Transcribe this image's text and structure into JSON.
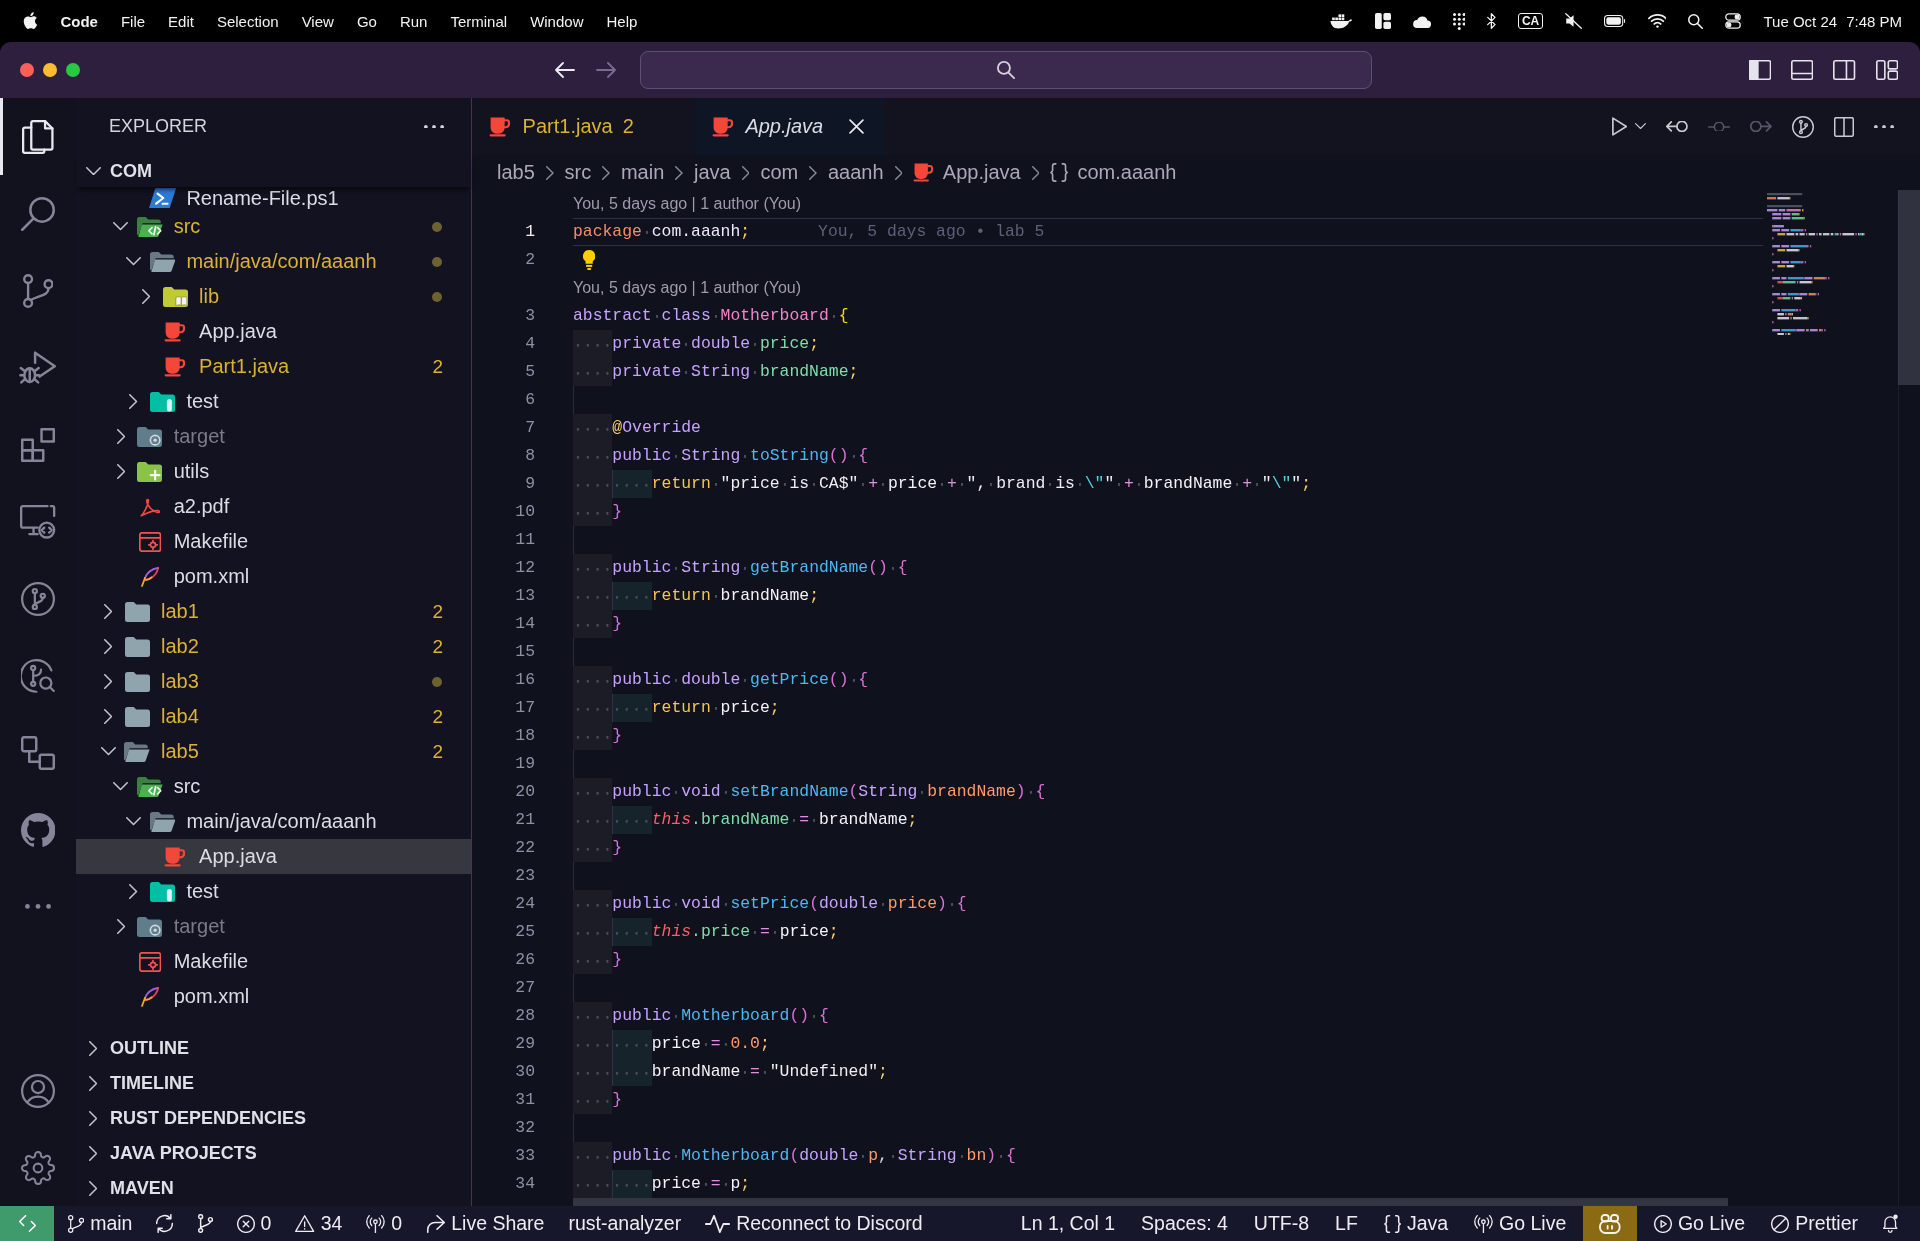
{
  "menu_bar": {
    "app_name": "Code",
    "menus": [
      "File",
      "Edit",
      "Selection",
      "View",
      "Go",
      "Run",
      "Terminal",
      "Window",
      "Help"
    ],
    "input_source": "CA",
    "date": "Tue Oct 24",
    "time": "7:48 PM"
  },
  "title_bar": {
    "navigation": [
      {
        "kind": "back",
        "disabled": false
      },
      {
        "kind": "forward",
        "disabled": true
      }
    ]
  },
  "activity_bar": {
    "items": [
      {
        "kind": "explorer",
        "selected": true
      },
      {
        "kind": "search",
        "selected": false
      },
      {
        "kind": "source-control",
        "selected": false
      },
      {
        "kind": "run-debug",
        "selected": false
      },
      {
        "kind": "extensions",
        "selected": false
      },
      {
        "kind": "remote",
        "selected": false
      },
      {
        "kind": "git-graph",
        "selected": false
      },
      {
        "kind": "gitlens",
        "selected": false
      },
      {
        "kind": "connections",
        "selected": false
      },
      {
        "kind": "github",
        "selected": false
      },
      {
        "kind": "more",
        "selected": false
      }
    ],
    "bottom_items": [
      {
        "kind": "account"
      },
      {
        "kind": "settings"
      }
    ]
  },
  "sidebar": {
    "title": "EXPLORER",
    "section": {
      "title": "COM",
      "expanded": true
    },
    "tree": [
      {
        "children": [
          {
            "children": [
              {
                "label": "Rename-File.ps1",
                "kind": "powershell",
                "modified": false,
                "ignored": false,
                "dot": false,
                "selected": false
              }
            ]
          },
          {
            "label": "src",
            "kind": "src-folder",
            "expanded": true,
            "modified": true,
            "ignored": false,
            "dot": true,
            "selected": false,
            "children": [
              {
                "label": "main/java/com/aaanh",
                "kind": "folder",
                "expanded": true,
                "modified": true,
                "ignored": false,
                "dot": true,
                "selected": false,
                "children": [
                  {
                    "label": "lib",
                    "kind": "lib-folder",
                    "expanded": false,
                    "modified": true,
                    "ignored": false,
                    "dot": true,
                    "selected": false
                  },
                  {
                    "label": "App.java",
                    "kind": "java",
                    "modified": false,
                    "ignored": false,
                    "dot": false,
                    "selected": false
                  },
                  {
                    "label": "Part1.java",
                    "kind": "java",
                    "modified": true,
                    "ignored": false,
                    "badge": "2",
                    "dot": false,
                    "selected": false
                  }
                ]
              },
              {
                "label": "test",
                "kind": "test-folder",
                "expanded": false,
                "modified": false,
                "ignored": false,
                "dot": false,
                "selected": false
              }
            ]
          },
          {
            "label": "target",
            "kind": "target-folder",
            "expanded": false,
            "modified": false,
            "ignored": true,
            "dot": false,
            "selected": false
          },
          {
            "label": "utils",
            "kind": "utils-folder",
            "expanded": false,
            "modified": false,
            "ignored": false,
            "dot": false,
            "selected": false
          },
          {
            "label": "a2.pdf",
            "kind": "pdf",
            "modified": false,
            "ignored": false,
            "dot": false,
            "selected": false
          },
          {
            "label": "Makefile",
            "kind": "makefile",
            "modified": false,
            "ignored": false,
            "dot": false,
            "selected": false
          },
          {
            "label": "pom.xml",
            "kind": "maven",
            "modified": false,
            "ignored": false,
            "dot": false,
            "selected": false
          }
        ]
      },
      {
        "label": "lab1",
        "kind": "folder",
        "expanded": false,
        "modified": true,
        "ignored": false,
        "badge": "2",
        "dot": false,
        "selected": false
      },
      {
        "label": "lab2",
        "kind": "folder",
        "expanded": false,
        "modified": true,
        "ignored": false,
        "badge": "2",
        "dot": false,
        "selected": false
      },
      {
        "label": "lab3",
        "kind": "folder",
        "expanded": false,
        "modified": true,
        "ignored": false,
        "dot": true,
        "selected": false
      },
      {
        "label": "lab4",
        "kind": "folder",
        "expanded": false,
        "modified": true,
        "ignored": false,
        "badge": "2",
        "dot": false,
        "selected": false
      },
      {
        "label": "lab5",
        "kind": "folder",
        "expanded": true,
        "modified": true,
        "ignored": false,
        "badge": "2",
        "dot": false,
        "selected": false,
        "children": [
          {
            "label": "src",
            "kind": "src-folder",
            "expanded": true,
            "modified": false,
            "ignored": false,
            "dot": false,
            "selected": false,
            "children": [
              {
                "label": "main/java/com/aaanh",
                "kind": "folder",
                "expanded": true,
                "modified": false,
                "ignored": false,
                "dot": false,
                "selected": false,
                "children": [
                  {
                    "label": "App.java",
                    "kind": "java",
                    "modified": false,
                    "ignored": false,
                    "dot": false,
                    "selected": true
                  }
                ]
              },
              {
                "label": "test",
                "kind": "test-folder",
                "expanded": false,
                "modified": false,
                "ignored": false,
                "dot": false,
                "selected": false
              }
            ]
          },
          {
            "label": "target",
            "kind": "target-folder",
            "expanded": false,
            "modified": false,
            "ignored": true,
            "dot": false,
            "selected": false
          },
          {
            "label": "Makefile",
            "kind": "makefile",
            "modified": false,
            "ignored": false,
            "dot": false,
            "selected": false
          },
          {
            "label": "pom.xml",
            "kind": "maven",
            "modified": false,
            "ignored": false,
            "dot": false,
            "selected": false
          }
        ]
      }
    ],
    "panels": [
      {
        "title": "OUTLINE",
        "expanded": false
      },
      {
        "title": "TIMELINE",
        "expanded": false
      },
      {
        "title": "RUST DEPENDENCIES",
        "expanded": false
      },
      {
        "title": "JAVA PROJECTS",
        "expanded": false
      },
      {
        "title": "MAVEN",
        "expanded": false
      }
    ]
  },
  "editor": {
    "tabs": [
      {
        "label": "Part1.java",
        "kind": "java",
        "modified": true,
        "badge": "2",
        "preview": false,
        "selected": false
      },
      {
        "label": "App.java",
        "kind": "java",
        "modified": false,
        "preview": true,
        "selected": true
      }
    ],
    "actions": [
      {
        "kind": "run",
        "disabled": false
      },
      {
        "kind": "run-options",
        "disabled": false
      },
      {
        "kind": "revert",
        "disabled": false
      },
      {
        "kind": "previous-change",
        "disabled": true
      },
      {
        "kind": "next-change",
        "disabled": true
      },
      {
        "kind": "graph",
        "disabled": false
      },
      {
        "kind": "split",
        "disabled": false
      },
      {
        "kind": "more",
        "disabled": false
      }
    ],
    "breadcrumbs": [
      {
        "label": "lab5",
        "kind": "folder"
      },
      {
        "label": "src",
        "kind": "folder"
      },
      {
        "label": "main",
        "kind": "folder"
      },
      {
        "label": "java",
        "kind": "folder"
      },
      {
        "label": "com",
        "kind": "folder"
      },
      {
        "label": "aaanh",
        "kind": "folder"
      },
      {
        "label": "App.java",
        "kind": "java"
      },
      {
        "label": "com.aaanh",
        "kind": "namespace"
      }
    ],
    "lines": [
      {
        "kind": "codelens",
        "text": "You, 5 days ago | 1 author (You)"
      },
      {
        "kind": "code",
        "number": "1",
        "current": true,
        "tokens": [
          {
            "text": "package",
            "kind": "package"
          },
          {
            "text": " com.aaanh",
            "kind": "namespace"
          },
          {
            "text": ";",
            "kind": "punct"
          }
        ],
        "blame": "You, 5 days ago • lab 5"
      },
      {
        "kind": "code",
        "number": "2",
        "current": false,
        "lightbulb": true
      },
      {
        "kind": "codelens",
        "text": "You, 5 days ago | 1 author (You)"
      },
      {
        "kind": "code",
        "number": "3",
        "current": false,
        "tokens": [
          {
            "text": "abstract class ",
            "kind": "keyword"
          },
          {
            "text": "Motherboard",
            "kind": "class"
          },
          {
            "text": " {",
            "kind": "bracket1"
          }
        ]
      },
      {
        "kind": "code",
        "number": "4",
        "current": false,
        "tokens": [
          {
            "text": "    private double ",
            "kind": "keyword"
          },
          {
            "text": "price",
            "kind": "field"
          },
          {
            "text": ";",
            "kind": "punct"
          }
        ]
      },
      {
        "kind": "code",
        "number": "5",
        "current": false,
        "tokens": [
          {
            "text": "    private String ",
            "kind": "keyword"
          },
          {
            "text": "brandName",
            "kind": "field"
          },
          {
            "text": ";",
            "kind": "punct"
          }
        ]
      },
      {
        "kind": "code",
        "number": "6",
        "current": false
      },
      {
        "kind": "code",
        "number": "7",
        "current": false,
        "tokens": [
          {
            "text": "    @",
            "kind": "annotation"
          },
          {
            "text": "Override",
            "kind": "keyword"
          }
        ]
      },
      {
        "kind": "code",
        "number": "8",
        "current": false,
        "tokens": [
          {
            "text": "    public String ",
            "kind": "keyword"
          },
          {
            "text": "toString",
            "kind": "method"
          },
          {
            "text": "() {",
            "kind": "bracket2"
          }
        ]
      },
      {
        "kind": "code",
        "number": "9",
        "current": false,
        "tokens": [
          {
            "text": "        return ",
            "kind": "control"
          },
          {
            "text": "\"price is CA$\"",
            "kind": "string"
          },
          {
            "text": " + ",
            "kind": "operator"
          },
          {
            "text": "price",
            "kind": "variable"
          },
          {
            "text": " + ",
            "kind": "operator"
          },
          {
            "text": "\", brand is ",
            "kind": "string"
          },
          {
            "text": "\\\"",
            "kind": "escape"
          },
          {
            "text": "\"",
            "kind": "string"
          },
          {
            "text": " + ",
            "kind": "operator"
          },
          {
            "text": "brandName",
            "kind": "variable"
          },
          {
            "text": " + ",
            "kind": "operator"
          },
          {
            "text": "\"",
            "kind": "string"
          },
          {
            "text": "\\\"",
            "kind": "escape"
          },
          {
            "text": "\"",
            "kind": "string"
          },
          {
            "text": ";",
            "kind": "punct"
          }
        ]
      },
      {
        "kind": "code",
        "number": "10",
        "current": false,
        "tokens": [
          {
            "text": "    }",
            "kind": "bracket2"
          }
        ]
      },
      {
        "kind": "code",
        "number": "11",
        "current": false
      },
      {
        "kind": "code",
        "number": "12",
        "current": false,
        "tokens": [
          {
            "text": "    public String ",
            "kind": "keyword"
          },
          {
            "text": "getBrandName",
            "kind": "method"
          },
          {
            "text": "() {",
            "kind": "bracket2"
          }
        ]
      },
      {
        "kind": "code",
        "number": "13",
        "current": false,
        "tokens": [
          {
            "text": "        return ",
            "kind": "control"
          },
          {
            "text": "brandName",
            "kind": "variable"
          },
          {
            "text": ";",
            "kind": "punct"
          }
        ]
      },
      {
        "kind": "code",
        "number": "14",
        "current": false,
        "tokens": [
          {
            "text": "    }",
            "kind": "bracket2"
          }
        ]
      },
      {
        "kind": "code",
        "number": "15",
        "current": false
      },
      {
        "kind": "code",
        "number": "16",
        "current": false,
        "tokens": [
          {
            "text": "    public double ",
            "kind": "keyword"
          },
          {
            "text": "getPrice",
            "kind": "method"
          },
          {
            "text": "() {",
            "kind": "bracket2"
          }
        ]
      },
      {
        "kind": "code",
        "number": "17",
        "current": false,
        "tokens": [
          {
            "text": "        return ",
            "kind": "control"
          },
          {
            "text": "price",
            "kind": "variable"
          },
          {
            "text": ";",
            "kind": "punct"
          }
        ]
      },
      {
        "kind": "code",
        "number": "18",
        "current": false,
        "tokens": [
          {
            "text": "    }",
            "kind": "bracket2"
          }
        ]
      },
      {
        "kind": "code",
        "number": "19",
        "current": false
      },
      {
        "kind": "code",
        "number": "20",
        "current": false,
        "tokens": [
          {
            "text": "    public void ",
            "kind": "keyword"
          },
          {
            "text": "setBrandName",
            "kind": "method"
          },
          {
            "text": "(",
            "kind": "bracket2"
          },
          {
            "text": "String ",
            "kind": "keyword"
          },
          {
            "text": "brandName",
            "kind": "parameter"
          },
          {
            "text": ") {",
            "kind": "bracket2"
          }
        ]
      },
      {
        "kind": "code",
        "number": "21",
        "current": false,
        "tokens": [
          {
            "text": "        this",
            "kind": "this"
          },
          {
            "text": ".brandName",
            "kind": "field"
          },
          {
            "text": " = ",
            "kind": "operator"
          },
          {
            "text": "brandName",
            "kind": "variable"
          },
          {
            "text": ";",
            "kind": "punct"
          }
        ]
      },
      {
        "kind": "code",
        "number": "22",
        "current": false,
        "tokens": [
          {
            "text": "    }",
            "kind": "bracket2"
          }
        ]
      },
      {
        "kind": "code",
        "number": "23",
        "current": false
      },
      {
        "kind": "code",
        "number": "24",
        "current": false,
        "tokens": [
          {
            "text": "    public void ",
            "kind": "keyword"
          },
          {
            "text": "setPrice",
            "kind": "method"
          },
          {
            "text": "(",
            "kind": "bracket2"
          },
          {
            "text": "double ",
            "kind": "keyword"
          },
          {
            "text": "price",
            "kind": "parameter"
          },
          {
            "text": ") {",
            "kind": "bracket2"
          }
        ]
      },
      {
        "kind": "code",
        "number": "25",
        "current": false,
        "tokens": [
          {
            "text": "        this",
            "kind": "this"
          },
          {
            "text": ".price",
            "kind": "field"
          },
          {
            "text": " = ",
            "kind": "operator"
          },
          {
            "text": "price",
            "kind": "variable"
          },
          {
            "text": ";",
            "kind": "punct"
          }
        ]
      },
      {
        "kind": "code",
        "number": "26",
        "current": false,
        "tokens": [
          {
            "text": "    }",
            "kind": "bracket2"
          }
        ]
      },
      {
        "kind": "code",
        "number": "27",
        "current": false
      },
      {
        "kind": "code",
        "number": "28",
        "current": false,
        "tokens": [
          {
            "text": "    public ",
            "kind": "keyword"
          },
          {
            "text": "Motherboard",
            "kind": "method"
          },
          {
            "text": "() {",
            "kind": "bracket2"
          }
        ]
      },
      {
        "kind": "code",
        "number": "29",
        "current": false,
        "tokens": [
          {
            "text": "        price",
            "kind": "variable"
          },
          {
            "text": " = ",
            "kind": "operator"
          },
          {
            "text": "0.0",
            "kind": "number"
          },
          {
            "text": ";",
            "kind": "punct"
          }
        ]
      },
      {
        "kind": "code",
        "number": "30",
        "current": false,
        "tokens": [
          {
            "text": "        brandName",
            "kind": "variable"
          },
          {
            "text": " = ",
            "kind": "operator"
          },
          {
            "text": "\"Undefined\"",
            "kind": "string"
          },
          {
            "text": ";",
            "kind": "punct"
          }
        ]
      },
      {
        "kind": "code",
        "number": "31",
        "current": false,
        "tokens": [
          {
            "text": "    }",
            "kind": "bracket2"
          }
        ]
      },
      {
        "kind": "code",
        "number": "32",
        "current": false
      },
      {
        "kind": "code",
        "number": "33",
        "current": false,
        "tokens": [
          {
            "text": "    public ",
            "kind": "keyword"
          },
          {
            "text": "Motherboard",
            "kind": "method"
          },
          {
            "text": "(",
            "kind": "bracket2"
          },
          {
            "text": "double ",
            "kind": "keyword"
          },
          {
            "text": "p",
            "kind": "parameter"
          },
          {
            "text": ", ",
            "kind": "plain"
          },
          {
            "text": "String ",
            "kind": "keyword"
          },
          {
            "text": "bn",
            "kind": "parameter"
          },
          {
            "text": ") {",
            "kind": "bracket2"
          }
        ]
      },
      {
        "kind": "code",
        "number": "34",
        "current": false,
        "tokens": [
          {
            "text": "        price",
            "kind": "variable"
          },
          {
            "text": " = ",
            "kind": "operator"
          },
          {
            "text": "p",
            "kind": "variable"
          },
          {
            "text": ";",
            "kind": "punct"
          }
        ]
      }
    ]
  },
  "status_bar": {
    "left": [
      {
        "kind": "remote"
      },
      {
        "kind": "branch",
        "label": "main"
      },
      {
        "kind": "sync"
      },
      {
        "kind": "graph"
      },
      {
        "kind": "problems",
        "errors": "0",
        "warnings": "34"
      },
      {
        "kind": "ports",
        "label": "0"
      },
      {
        "kind": "liveshare",
        "label": "Live Share"
      },
      {
        "kind": "text",
        "label": "rust-analyzer"
      },
      {
        "kind": "discord",
        "label": "Reconnect to Discord"
      }
    ],
    "right": [
      {
        "kind": "text",
        "label": "Ln 1, Col 1"
      },
      {
        "kind": "text",
        "label": "Spaces: 4"
      },
      {
        "kind": "text",
        "label": "UTF-8"
      },
      {
        "kind": "text",
        "label": "LF"
      },
      {
        "kind": "language",
        "label": "Java"
      },
      {
        "kind": "broadcast",
        "label": "Go Live"
      },
      {
        "kind": "copilot"
      },
      {
        "kind": "play",
        "label": "Go Live"
      },
      {
        "kind": "prettier",
        "label": "Prettier"
      },
      {
        "kind": "bell"
      }
    ]
  }
}
